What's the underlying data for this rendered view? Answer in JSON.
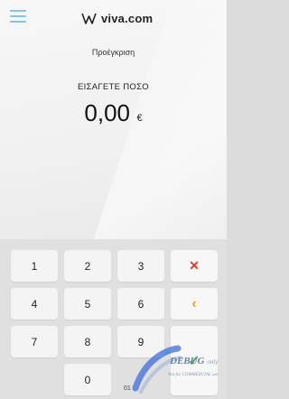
{
  "header": {
    "brand": "viva.com",
    "menu_icon": "hamburger-menu-icon",
    "logo_icon": "viva-logo-icon"
  },
  "screen": {
    "subtitle": "Προέγκριση",
    "prompt": "ΕΙΣΑΓΕΤΕ ΠΟΣΟ",
    "amount": "0,00",
    "currency": "€"
  },
  "keypad": {
    "keys": [
      "1",
      "2",
      "3",
      "4",
      "5",
      "6",
      "7",
      "8",
      "9",
      "0"
    ],
    "delete_icon": "close-icon",
    "backspace_icon": "chevron-left-icon",
    "confirm_icon": "check-icon",
    "extra_label": "01"
  },
  "watermark": {
    "text": "DEBUG",
    "suffix": "only",
    "subtext": "Not for COMMERCIAL use"
  },
  "colors": {
    "accent_blue": "#7fc7e3",
    "delete_red": "#e53935",
    "back_orange": "#f2a300",
    "confirm_green": "#4caf50"
  }
}
